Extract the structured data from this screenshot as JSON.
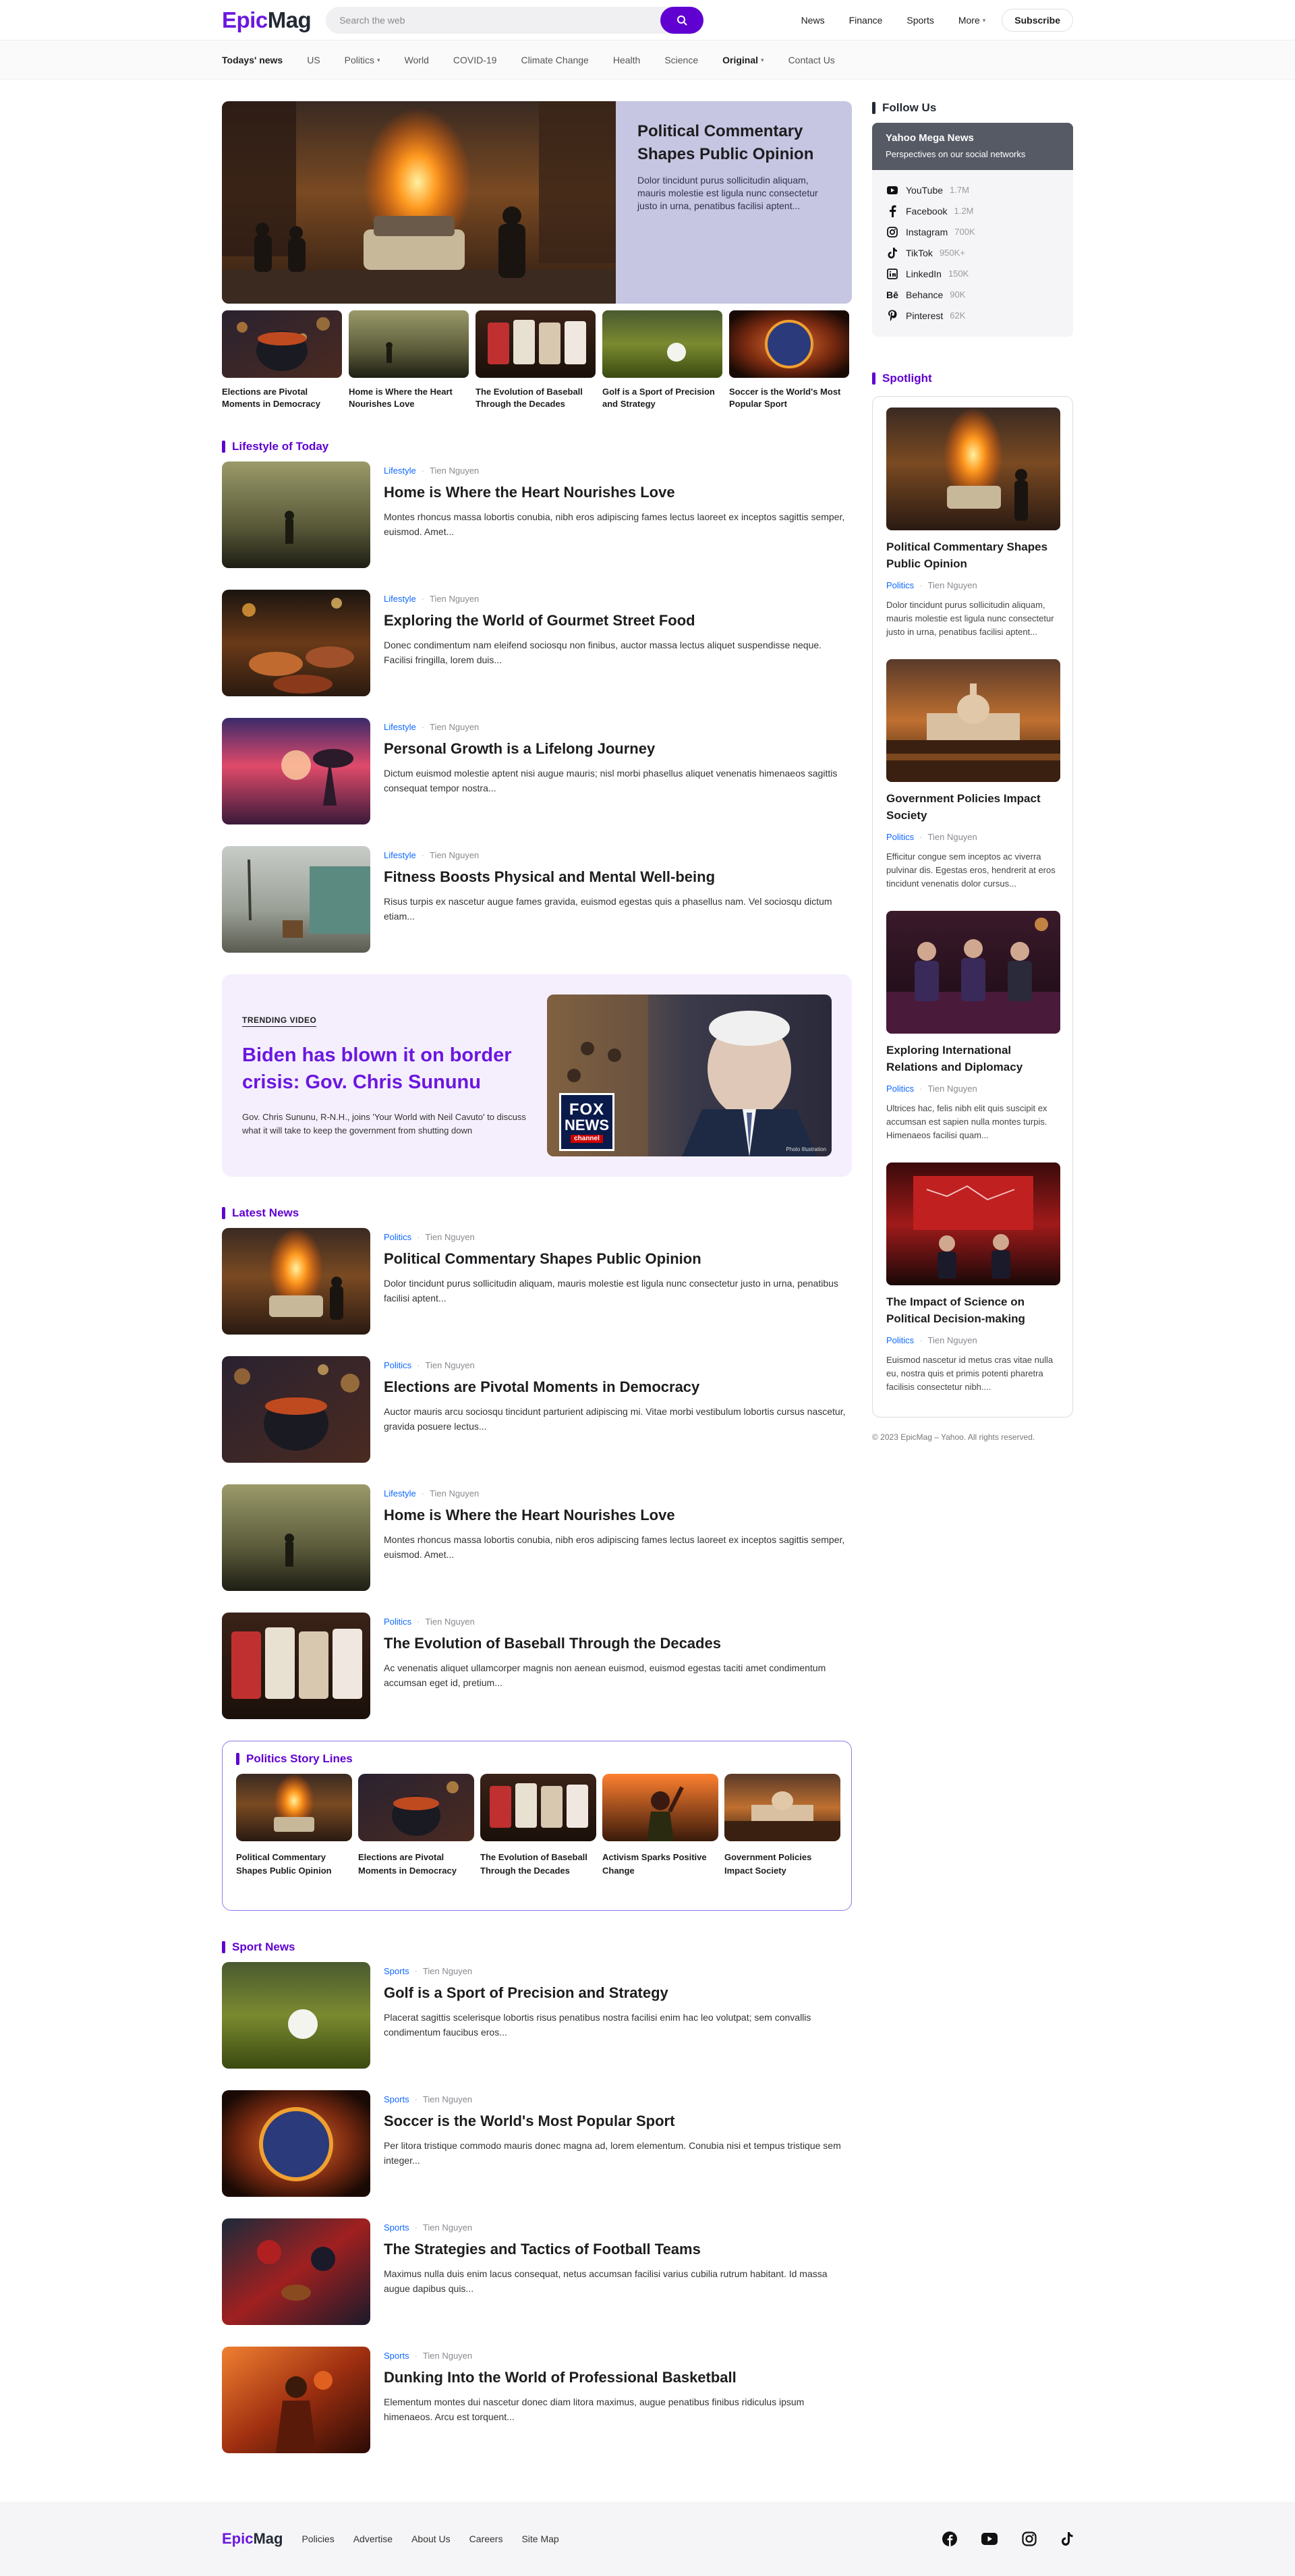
{
  "brand": {
    "part1": "Epic",
    "part2": "Mag"
  },
  "search": {
    "placeholder": "Search the web"
  },
  "topnav": {
    "news": "News",
    "finance": "Finance",
    "sports": "Sports",
    "more": "More",
    "subscribe": "Subscribe"
  },
  "catnav": [
    "Todays' news",
    "US",
    "Politics",
    "World",
    "COVID-19",
    "Climate Change",
    "Health",
    "Science",
    "Original",
    "Contact Us"
  ],
  "hero": {
    "title": "Political Commentary Shapes Public Opinion",
    "desc": "Dolor tincidunt purus sollicitudin aliquam, mauris molestie est ligula nunc consectetur justo in urna, penatibus facilisi aptent..."
  },
  "hero_thumbs": [
    "Elections are Pivotal Moments in Democracy",
    "Home is Where the Heart Nourishes Love",
    "The Evolution of Baseball Through the Decades",
    "Golf is a Sport of Precision and Strategy",
    "Soccer is the World's Most Popular Sport"
  ],
  "lifestyle": {
    "heading": "Lifestyle of Today",
    "articles": [
      {
        "cat": "Lifestyle",
        "author": "Tien Nguyen",
        "title": "Home is Where the Heart Nourishes Love",
        "desc": "Montes rhoncus massa lobortis conubia, nibh eros adipiscing fames lectus laoreet ex inceptos sagittis semper, euismod. Amet..."
      },
      {
        "cat": "Lifestyle",
        "author": "Tien Nguyen",
        "title": "Exploring the World of Gourmet Street Food",
        "desc": "Donec condimentum nam eleifend sociosqu non finibus, auctor massa lectus aliquet suspendisse neque. Facilisi fringilla, lorem duis..."
      },
      {
        "cat": "Lifestyle",
        "author": "Tien Nguyen",
        "title": "Personal Growth is a Lifelong Journey",
        "desc": "Dictum euismod molestie aptent nisi augue mauris; nisl morbi phasellus aliquet venenatis himenaeos sagittis consequat tempor nostra..."
      },
      {
        "cat": "Lifestyle",
        "author": "Tien Nguyen",
        "title": "Fitness Boosts Physical and Mental Well-being",
        "desc": "Risus turpis ex nascetur augue fames gravida, euismod egestas quis a phasellus nam. Vel sociosqu dictum etiam..."
      }
    ]
  },
  "trending": {
    "label": "TRENDING VIDEO",
    "title": "Biden has blown it on border crisis: Gov. Chris Sununu",
    "desc": "Gov. Chris Sununu, R-N.H., joins 'Your World with Neil Cavuto' to discuss what it will take to keep the government from shutting down",
    "logo1": "FOX",
    "logo2": "NEWS",
    "logo3": "channel",
    "caption": "Photo Illustration"
  },
  "latest": {
    "heading": "Latest News",
    "articles": [
      {
        "cat": "Politics",
        "author": "Tien Nguyen",
        "title": "Political Commentary Shapes Public Opinion",
        "desc": "Dolor tincidunt purus sollicitudin aliquam, mauris molestie est ligula nunc consectetur justo in urna, penatibus facilisi aptent..."
      },
      {
        "cat": "Politics",
        "author": "Tien Nguyen",
        "title": "Elections are Pivotal Moments in Democracy",
        "desc": "Auctor mauris arcu sociosqu tincidunt parturient adipiscing mi. Vitae morbi vestibulum lobortis cursus nascetur, gravida posuere lectus..."
      },
      {
        "cat": "Lifestyle",
        "author": "Tien Nguyen",
        "title": "Home is Where the Heart Nourishes Love",
        "desc": "Montes rhoncus massa lobortis conubia, nibh eros adipiscing fames lectus laoreet ex inceptos sagittis semper, euismod. Amet..."
      },
      {
        "cat": "Politics",
        "author": "Tien Nguyen",
        "title": "The Evolution of Baseball Through the Decades",
        "desc": "Ac venenatis aliquet ullamcorper magnis non aenean euismod, euismod egestas taciti amet condimentum accumsan eget id, pretium..."
      }
    ]
  },
  "storylines": {
    "heading": "Politics Story Lines",
    "items": [
      "Political Commentary Shapes Public Opinion",
      "Elections are Pivotal Moments in Democracy",
      "The Evolution of Baseball Through the Decades",
      "Activism Sparks Positive Change",
      "Government Policies Impact Society"
    ]
  },
  "sport": {
    "heading": "Sport News",
    "articles": [
      {
        "cat": "Sports",
        "author": "Tien Nguyen",
        "title": "Golf is a Sport of Precision and Strategy",
        "desc": "Placerat sagittis scelerisque lobortis risus penatibus nostra facilisi enim hac leo volutpat; sem convallis condimentum faucibus eros..."
      },
      {
        "cat": "Sports",
        "author": "Tien Nguyen",
        "title": "Soccer is the World's Most Popular Sport",
        "desc": "Per litora tristique commodo mauris donec magna ad, lorem elementum. Conubia nisi et tempus tristique sem integer..."
      },
      {
        "cat": "Sports",
        "author": "Tien Nguyen",
        "title": "The Strategies and Tactics of Football Teams",
        "desc": "Maximus nulla duis enim lacus consequat, netus accumsan facilisi varius cubilia rutrum habitant. Id massa augue dapibus quis..."
      },
      {
        "cat": "Sports",
        "author": "Tien Nguyen",
        "title": "Dunking Into the World of Professional Basketball",
        "desc": "Elementum montes dui nascetur donec diam litora maximus, augue penatibus finibus ridiculus ipsum himenaeos. Arcu est torquent..."
      }
    ]
  },
  "follow": {
    "heading": "Follow Us",
    "box_title": "Yahoo Mega News",
    "box_sub": "Perspectives on our social networks",
    "items": [
      {
        "name": "YouTube",
        "count": "1.7M",
        "icon": "youtube-icon"
      },
      {
        "name": "Facebook",
        "count": "1.2M",
        "icon": "facebook-icon"
      },
      {
        "name": "Instagram",
        "count": "700K",
        "icon": "instagram-icon"
      },
      {
        "name": "TikTok",
        "count": "950K+",
        "icon": "tiktok-icon"
      },
      {
        "name": "LinkedIn",
        "count": "150K",
        "icon": "linkedin-icon"
      },
      {
        "name": "Behance",
        "count": "90K",
        "icon": "behance-icon"
      },
      {
        "name": "Pinterest",
        "count": "62K",
        "icon": "pinterest-icon"
      }
    ]
  },
  "spotlight": {
    "heading": "Spotlight",
    "cards": [
      {
        "title": "Political Commentary Shapes Public Opinion",
        "cat": "Politics",
        "author": "Tien Nguyen",
        "desc": "Dolor tincidunt purus sollicitudin aliquam, mauris molestie est ligula nunc consectetur justo in urna, penatibus facilisi aptent..."
      },
      {
        "title": "Government Policies Impact Society",
        "cat": "Politics",
        "author": "Tien Nguyen",
        "desc": "Efficitur congue sem inceptos ac viverra pulvinar dis. Egestas eros, hendrerit at eros tincidunt venenatis dolor cursus..."
      },
      {
        "title": "Exploring International Relations and Diplomacy",
        "cat": "Politics",
        "author": "Tien Nguyen",
        "desc": "Ultrices hac, felis nibh elit quis suscipit ex accumsan est sapien nulla montes turpis. Himenaeos facilisi quam..."
      },
      {
        "title": "The Impact of Science on Political Decision-making",
        "cat": "Politics",
        "author": "Tien Nguyen",
        "desc": "Euismod nascetur id metus cras vitae nulla eu, nostra quis et primis potenti pharetra facilisis consectetur nibh...."
      }
    ]
  },
  "copyright": "© 2023 EpicMag – Yahoo. All rights reserved.",
  "footer": {
    "links": [
      "Policies",
      "Advertise",
      "About Us",
      "Careers",
      "Site Map"
    ]
  },
  "colors": {
    "accent": "#6001d2",
    "link": "#0f69ff",
    "hero_panel": "#c6c5e2",
    "trend_bg": "#f5effd"
  }
}
